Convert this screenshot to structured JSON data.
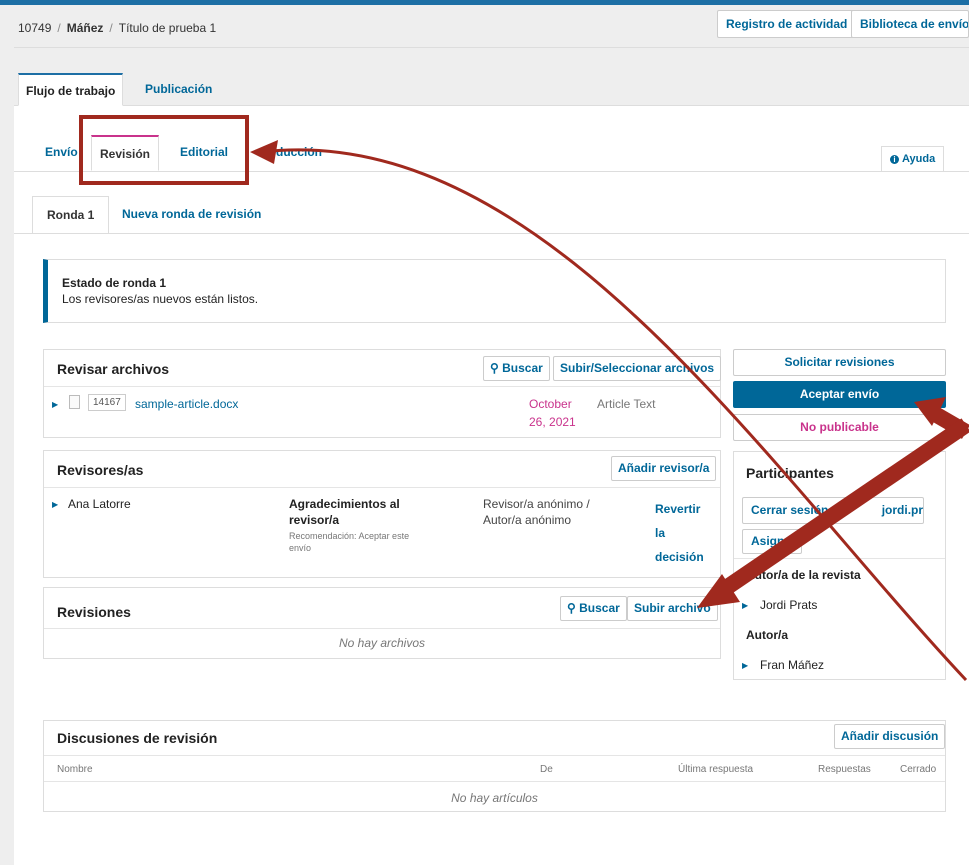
{
  "breadcrumb": {
    "id": "10749",
    "author": "Máñez",
    "title": "Título de prueba 1"
  },
  "header_buttons": {
    "activity_log": "Registro de actividad",
    "library": "Biblioteca de envío"
  },
  "main_tabs": {
    "workflow": "Flujo de trabajo",
    "publication": "Publicación"
  },
  "stage_tabs": {
    "submission": "Envío",
    "review": "Revisión",
    "editorial": "Editorial",
    "production_partial": "ducción"
  },
  "help": {
    "label": "Ayuda"
  },
  "round_tabs": {
    "round1": "Ronda 1",
    "new_round": "Nueva ronda de revisión"
  },
  "status": {
    "title": "Estado de ronda 1",
    "description": "Los revisores/as nuevos están listos."
  },
  "review_files": {
    "title": "Revisar archivos",
    "search": "Buscar",
    "upload": "Subir/Seleccionar archivos",
    "file": {
      "id": "14167",
      "name": "sample-article.docx",
      "date_line1": "October",
      "date_line2": "26, 2021",
      "type": "Article Text"
    }
  },
  "reviewers": {
    "title": "Revisores/as",
    "add": "Añadir revisor/a",
    "row": {
      "name": "Ana Latorre",
      "status_line1": "Agradecimientos al",
      "status_line2": "revisor/a",
      "recommendation_line1": "Recomendación: Aceptar este",
      "recommendation_line2": "envío",
      "method_line1": "Revisor/a anónimo /",
      "method_line2": "Autor/a anónimo",
      "action_line1": "Revertir",
      "action_line2": "la",
      "action_line3": "decisión"
    }
  },
  "revisions": {
    "title": "Revisiones",
    "search": "Buscar",
    "upload": "Subir archivo",
    "empty": "No hay archivos"
  },
  "decisions": {
    "request": "Solicitar revisiones",
    "accept": "Aceptar envío",
    "decline": "No publicable"
  },
  "participants": {
    "title": "Participantes",
    "logout_visible_left": "Cerrar sesión",
    "logout_visible_right": "jordi.prats",
    "assign_partial": "Asign",
    "role1_partial": "utor/a de la revista",
    "role1_partial_prefix": "A",
    "person1": "Jordi Prats",
    "role2": "Autor/a",
    "person2": "Fran Máñez"
  },
  "discussions": {
    "title": "Discusiones de revisión",
    "add": "Añadir discusión",
    "columns": [
      "Nombre",
      "De",
      "Última respuesta",
      "Respuestas",
      "Cerrado"
    ],
    "empty": "No hay artículos"
  },
  "colors": {
    "primary": "#006798",
    "pink": "#c9338c",
    "annotation": "#a0291e"
  }
}
